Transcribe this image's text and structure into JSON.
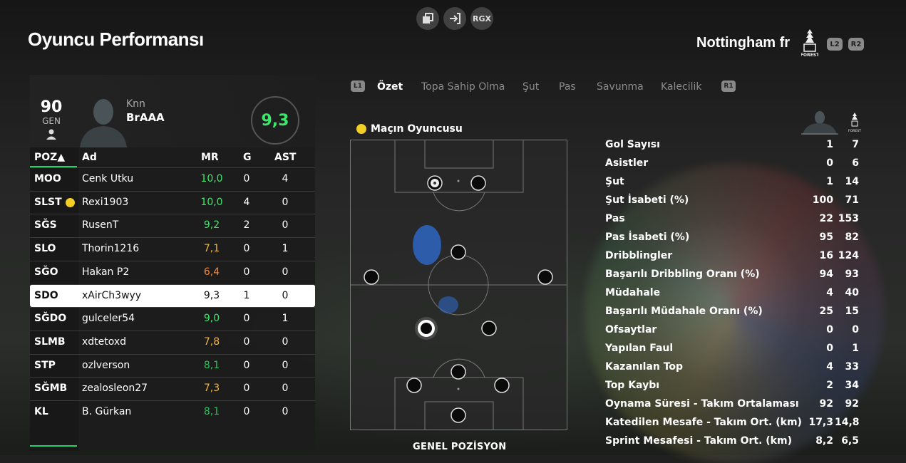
{
  "top_icons": [
    {
      "icon": "overlay-icon",
      "label": ""
    },
    {
      "icon": "exit-icon",
      "label": ""
    },
    {
      "icon": "rgx-icon",
      "label": "RGX"
    }
  ],
  "header": {
    "title": "Oyuncu Performansı",
    "team_name": "Nottingham fr",
    "crest_text": "FOREST",
    "btn_l2": "L2",
    "btn_r2": "R2"
  },
  "player": {
    "gen_value": "90",
    "gen_label": "GEN",
    "first_name": "Knn",
    "last_name": "BrAAA",
    "rating": "9,3"
  },
  "table": {
    "headers": {
      "pos": "POZ▲",
      "name": "Ad",
      "mr": "MR",
      "g": "G",
      "ast": "AST"
    },
    "rows": [
      {
        "pos": "MOO",
        "name": "Cenk Utku",
        "mr": "10,0",
        "mr_color": "#3be86a",
        "g": "0",
        "ast": "4",
        "motm": false,
        "selected": false
      },
      {
        "pos": "SLST",
        "name": "Rexi1903",
        "mr": "10,0",
        "mr_color": "#3be86a",
        "g": "4",
        "ast": "0",
        "motm": true,
        "selected": false
      },
      {
        "pos": "SĞS",
        "name": "RusenT",
        "mr": "9,2",
        "mr_color": "#3be86a",
        "g": "2",
        "ast": "0",
        "motm": false,
        "selected": false
      },
      {
        "pos": "SLO",
        "name": "Thorin1216",
        "mr": "7,1",
        "mr_color": "#f0b43a",
        "g": "0",
        "ast": "1",
        "motm": false,
        "selected": false
      },
      {
        "pos": "SĞO",
        "name": "Hakan P2",
        "mr": "6,4",
        "mr_color": "#f0883a",
        "g": "0",
        "ast": "0",
        "motm": false,
        "selected": false
      },
      {
        "pos": "SDO",
        "name": "xAirCh3wyy",
        "mr": "9,3",
        "mr_color": "#111111",
        "g": "1",
        "ast": "0",
        "motm": false,
        "selected": true
      },
      {
        "pos": "SĞDO",
        "name": "gulceler54",
        "mr": "9,0",
        "mr_color": "#3be86a",
        "g": "0",
        "ast": "1",
        "motm": false,
        "selected": false
      },
      {
        "pos": "SLMB",
        "name": "xdtetoxd",
        "mr": "7,8",
        "mr_color": "#f0b43a",
        "g": "0",
        "ast": "0",
        "motm": false,
        "selected": false
      },
      {
        "pos": "STP",
        "name": "ozlverson",
        "mr": "8,1",
        "mr_color": "#2fbf5a",
        "g": "0",
        "ast": "0",
        "motm": false,
        "selected": false
      },
      {
        "pos": "SĞMB",
        "name": "zealosleon27",
        "mr": "7,3",
        "mr_color": "#f0b43a",
        "g": "0",
        "ast": "0",
        "motm": false,
        "selected": false
      },
      {
        "pos": "KL",
        "name": "B. Gürkan",
        "mr": "8,1",
        "mr_color": "#2fbf5a",
        "g": "0",
        "ast": "0",
        "motm": false,
        "selected": false
      }
    ]
  },
  "tabs": {
    "l1": "L1",
    "r1": "R1",
    "items": [
      "Özet",
      "Topa Sahip Olma",
      "Şut",
      "Pas",
      "Savunma",
      "Kalecilik"
    ],
    "active": 0
  },
  "pitch": {
    "motm_label": "Maçın Oyuncusu",
    "position_label": "GENEL POZİSYON"
  },
  "stats": [
    {
      "label": "Gol Sayısı",
      "player": "1",
      "team": "7"
    },
    {
      "label": "Asistler",
      "player": "0",
      "team": "6"
    },
    {
      "label": "Şut",
      "player": "1",
      "team": "14"
    },
    {
      "label": "Şut İsabeti (%)",
      "player": "100",
      "team": "71"
    },
    {
      "label": "Pas",
      "player": "22",
      "team": "153"
    },
    {
      "label": "Pas İsabeti (%)",
      "player": "95",
      "team": "82"
    },
    {
      "label": "Dribblingler",
      "player": "16",
      "team": "124"
    },
    {
      "label": "Başarılı Dribbling Oranı (%)",
      "player": "94",
      "team": "93"
    },
    {
      "label": "Müdahale",
      "player": "4",
      "team": "40"
    },
    {
      "label": "Başarılı Müdahale Oranı (%)",
      "player": "25",
      "team": "15"
    },
    {
      "label": "Ofsaytlar",
      "player": "0",
      "team": "0"
    },
    {
      "label": "Yapılan Faul",
      "player": "0",
      "team": "1"
    },
    {
      "label": "Kazanılan Top",
      "player": "4",
      "team": "33"
    },
    {
      "label": "Top Kaybı",
      "player": "2",
      "team": "34"
    },
    {
      "label": "Oynama Süresi - Takım Ortalaması",
      "player": "92",
      "team": "92"
    },
    {
      "label": "Katedilen Mesafe - Takım Ort. (km)",
      "player": "17,3",
      "team": "14,8"
    },
    {
      "label": "Sprint Mesafesi - Takım Ort. (km)",
      "player": "8,2",
      "team": "6,5"
    }
  ],
  "colors": {
    "accent": "#1fd36a",
    "gold": "#f2cf24",
    "heatmap": "#2f6fd6"
  }
}
